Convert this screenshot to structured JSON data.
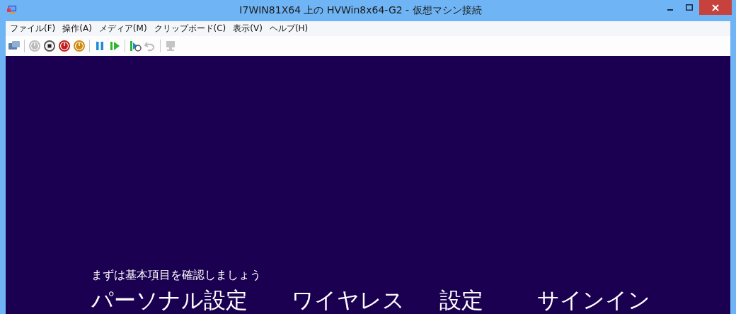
{
  "window": {
    "title": "I7WIN81X64 上の HVWin8x64-G2  - 仮想マシン接続"
  },
  "menu": [
    "ファイル(F)",
    "操作(A)",
    "メディア(M)",
    "クリップボード(C)",
    "表示(V)",
    "ヘルプ(H)"
  ],
  "toolbar": [
    {
      "kind": "ctrlaltdel",
      "disabled": false
    },
    {
      "kind": "sep"
    },
    {
      "kind": "start",
      "disabled": true
    },
    {
      "kind": "stop",
      "disabled": false
    },
    {
      "kind": "shutdown",
      "disabled": false
    },
    {
      "kind": "save",
      "disabled": false
    },
    {
      "kind": "sep"
    },
    {
      "kind": "pause",
      "disabled": false
    },
    {
      "kind": "resume",
      "disabled": false
    },
    {
      "kind": "sep"
    },
    {
      "kind": "checkpoint",
      "disabled": false
    },
    {
      "kind": "revert",
      "disabled": true
    },
    {
      "kind": "sep"
    },
    {
      "kind": "enhanced",
      "disabled": true
    }
  ],
  "screen": {
    "subtitle": "まずは基本項目を確認しましょう",
    "steps": [
      "パーソナル設定",
      "ワイヤレス",
      "設定",
      "サインイン"
    ]
  }
}
